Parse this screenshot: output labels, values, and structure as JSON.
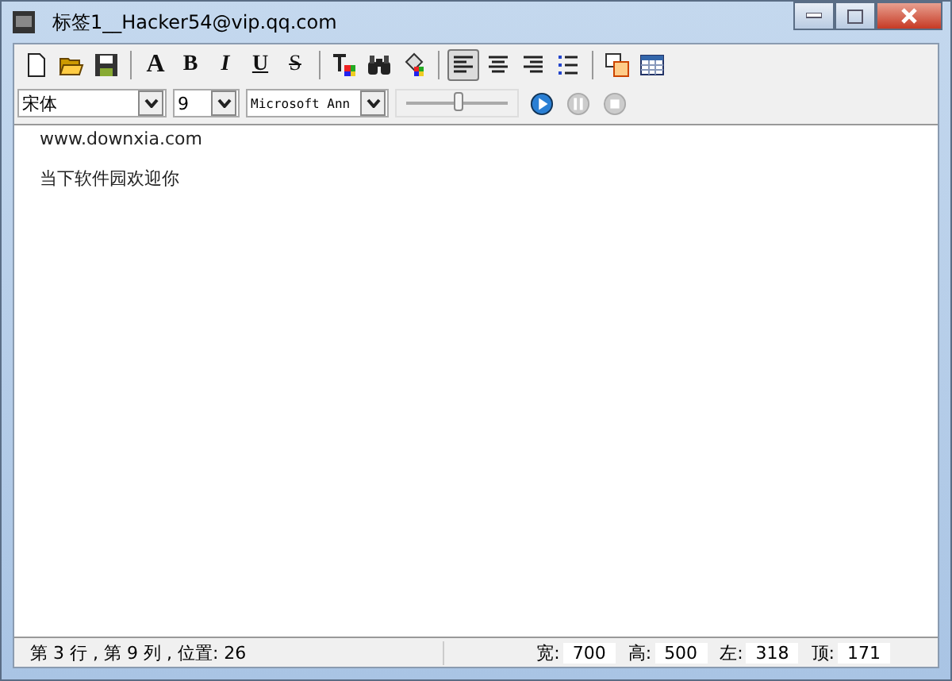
{
  "window": {
    "title": "标签1__Hacker54@vip.qq.com"
  },
  "toolbar": [
    {
      "kind": "new"
    },
    {
      "kind": "open"
    },
    {
      "kind": "save"
    },
    {
      "kind": "sep"
    },
    {
      "kind": "font",
      "label": "A"
    },
    {
      "kind": "bold",
      "label": "B"
    },
    {
      "kind": "italic",
      "label": "I"
    },
    {
      "kind": "underline",
      "label": "U"
    },
    {
      "kind": "strike",
      "label": "S"
    },
    {
      "kind": "sep"
    },
    {
      "kind": "textcolor"
    },
    {
      "kind": "find"
    },
    {
      "kind": "fill"
    },
    {
      "kind": "sep"
    },
    {
      "kind": "align-left",
      "selected": true
    },
    {
      "kind": "align-center",
      "selected": false
    },
    {
      "kind": "align-right",
      "selected": false
    },
    {
      "kind": "list",
      "selected": false
    },
    {
      "kind": "sep"
    },
    {
      "kind": "window"
    },
    {
      "kind": "table"
    }
  ],
  "format_bar": {
    "font": "宋体",
    "size": "9",
    "font2": "Microsoft Ann",
    "slider": {
      "level": 0.52
    },
    "media": [
      {
        "kind": "play",
        "disabled": false
      },
      {
        "kind": "pause",
        "disabled": true
      },
      {
        "kind": "stop",
        "disabled": true
      }
    ]
  },
  "editor": {
    "lines": [
      "www.downxia.com",
      "当下软件园欢迎你"
    ]
  },
  "status_bar": {
    "position": "第 3 行 , 第 9 列 , 位置: 26",
    "fields": [
      {
        "label": "宽:",
        "value": "700"
      },
      {
        "label": "高:",
        "value": "500"
      },
      {
        "label": "左:",
        "value": "318"
      },
      {
        "label": "顶:",
        "value": "171"
      }
    ]
  }
}
